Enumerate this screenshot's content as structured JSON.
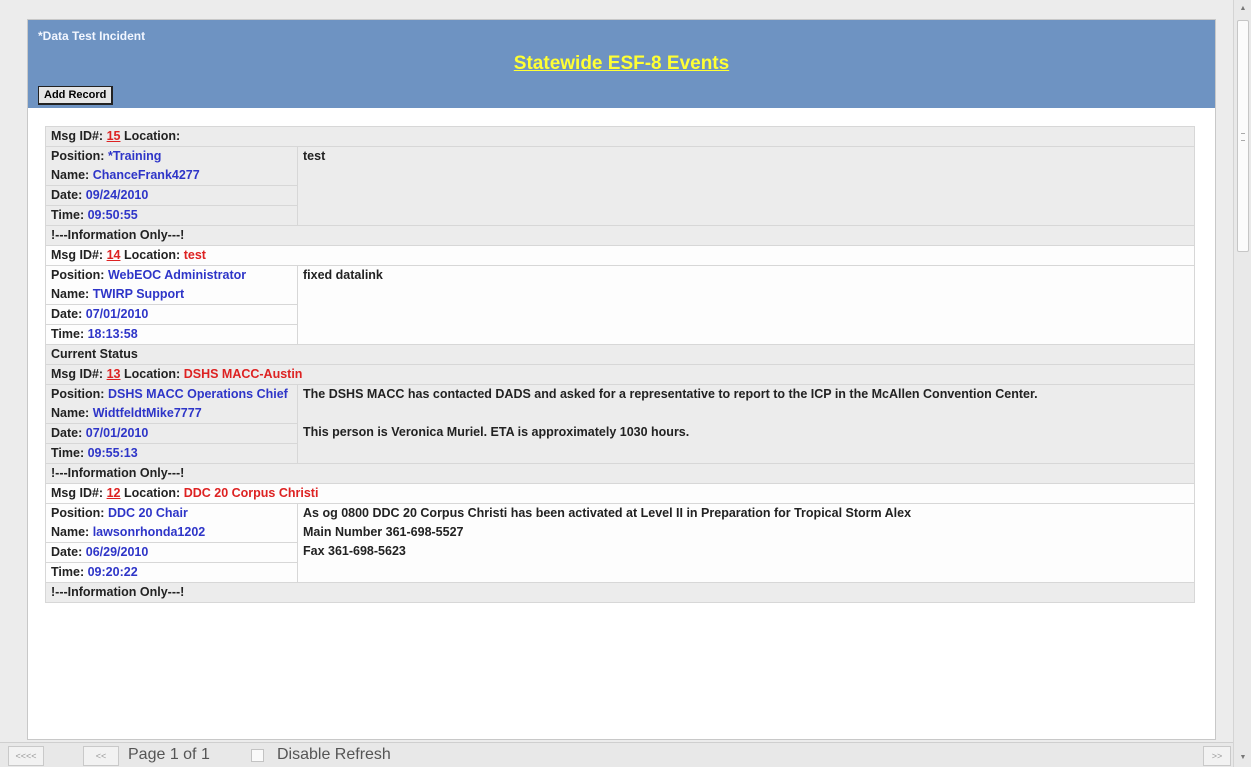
{
  "header": {
    "incident": "*Data Test Incident",
    "title": "Statewide ESF-8 Events",
    "add_button": "Add Record"
  },
  "labels": {
    "msg_id": "Msg ID#:",
    "location": "Location:",
    "position": "Position:",
    "name": "Name:",
    "date": "Date:",
    "time": "Time:"
  },
  "records": [
    {
      "id": "15",
      "location": "",
      "position": "*Training",
      "name": "ChanceFrank4277",
      "date": "09/24/2010",
      "time": "09:50:55",
      "message": [
        "test"
      ],
      "footer": "!---Information Only---!"
    },
    {
      "id": "14",
      "location": "test",
      "position": "WebEOC Administrator",
      "name": "TWIRP Support",
      "date": "07/01/2010",
      "time": "18:13:58",
      "message": [
        "fixed datalink"
      ],
      "footer": "Current Status"
    },
    {
      "id": "13",
      "location": "DSHS MACC-Austin",
      "position": "DSHS MACC Operations Chief",
      "name": "WidtfeldtMike7777",
      "date": "07/01/2010",
      "time": "09:55:13",
      "message": [
        "The DSHS MACC has contacted DADS and asked for a representative to report to the ICP in the McAllen Convention Center.",
        "This person is Veronica Muriel. ETA is approximately 1030 hours."
      ],
      "footer": "!---Information Only---!"
    },
    {
      "id": "12",
      "location": "DDC 20 Corpus Christi",
      "position": "DDC 20 Chair",
      "name": "lawsonrhonda1202",
      "date": "06/29/2010",
      "time": "09:20:22",
      "message": [
        "As og 0800 DDC 20 Corpus Christi has been activated at Level II in Preparation for Tropical Storm Alex\nMain Number 361-698-5527\nFax 361-698-5623"
      ],
      "footer": "!---Information Only---!"
    }
  ],
  "pager": {
    "first": "<<<<",
    "prev": "<<",
    "page_info": "Page 1 of 1",
    "disable_refresh": "Disable Refresh",
    "next": ">>"
  }
}
